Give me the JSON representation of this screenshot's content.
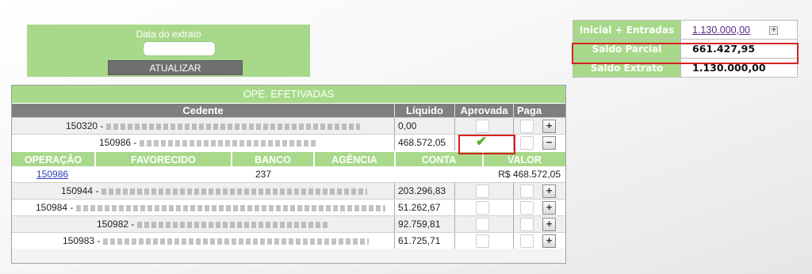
{
  "date_panel": {
    "label": "Data do extrato",
    "date_value": "",
    "button_label": "ATUALIZAR"
  },
  "summary": {
    "rows": [
      {
        "label": "Inicial + Entradas",
        "value": "1.130.000,00",
        "expand": "+"
      },
      {
        "label": "Saldo Parcial",
        "value": "661.427,95"
      },
      {
        "label": "Saldo Extrato",
        "value": "1.130.000,00"
      }
    ]
  },
  "ops": {
    "title": "OPE. EFETIVADAS",
    "columns": {
      "cedente": "Cedente",
      "liquido": "Líquido",
      "aprovada": "Aprovada",
      "paga": "Paga"
    },
    "rows": [
      {
        "code": "150320 -",
        "liquido": "0,00",
        "approved": false,
        "toggle": "+"
      },
      {
        "code": "150986 -",
        "liquido": "468.572,05",
        "approved": true,
        "toggle": "−"
      },
      {
        "code": "150944 -",
        "liquido": "203.296,83",
        "approved": false,
        "toggle": "+"
      },
      {
        "code": "150984 -",
        "liquido": "51.262,67",
        "approved": false,
        "toggle": "+"
      },
      {
        "code": "150982 -",
        "liquido": "92.759,81",
        "approved": false,
        "toggle": "+"
      },
      {
        "code": "150983 -",
        "liquido": "61.725,71",
        "approved": false,
        "toggle": "+"
      }
    ],
    "detail": {
      "columns": {
        "operacao": "OPERAÇÃO",
        "favorecido": "FAVORECIDO",
        "banco": "BANCO",
        "agencia": "AGÊNCIA",
        "conta": "CONTA",
        "valor": "VALOR"
      },
      "row": {
        "operacao": "150986",
        "favorecido": "",
        "banco": "237",
        "agencia": "",
        "conta": "",
        "valor": "R$ 468.572,05"
      }
    }
  },
  "colors": {
    "accent_green": "#a8d98a",
    "header_gray": "#7f7f7f",
    "highlight_red": "#d62222",
    "check_green": "#5ab02e"
  }
}
